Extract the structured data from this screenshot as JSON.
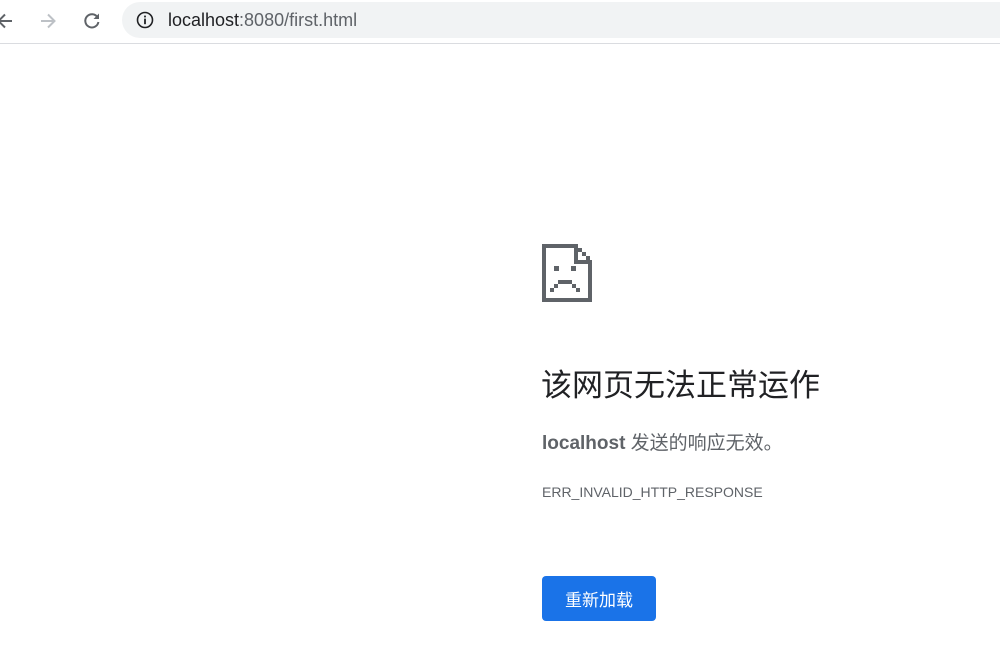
{
  "browser": {
    "url_host": "localhost",
    "url_rest": ":8080/first.html",
    "icons": {
      "back": "arrow-left-icon",
      "forward": "arrow-right-icon",
      "reload": "reload-icon",
      "site_info": "info-icon"
    }
  },
  "error": {
    "icon": "sad-page-icon",
    "title": "该网页无法正常运作",
    "host": "localhost",
    "message": " 发送的响应无效。",
    "code": "ERR_INVALID_HTTP_RESPONSE",
    "reload_label": "重新加载"
  },
  "colors": {
    "accent": "#1a73e8",
    "text_primary": "#202124",
    "text_secondary": "#5f6368",
    "omnibox_bg": "#f1f3f4"
  }
}
